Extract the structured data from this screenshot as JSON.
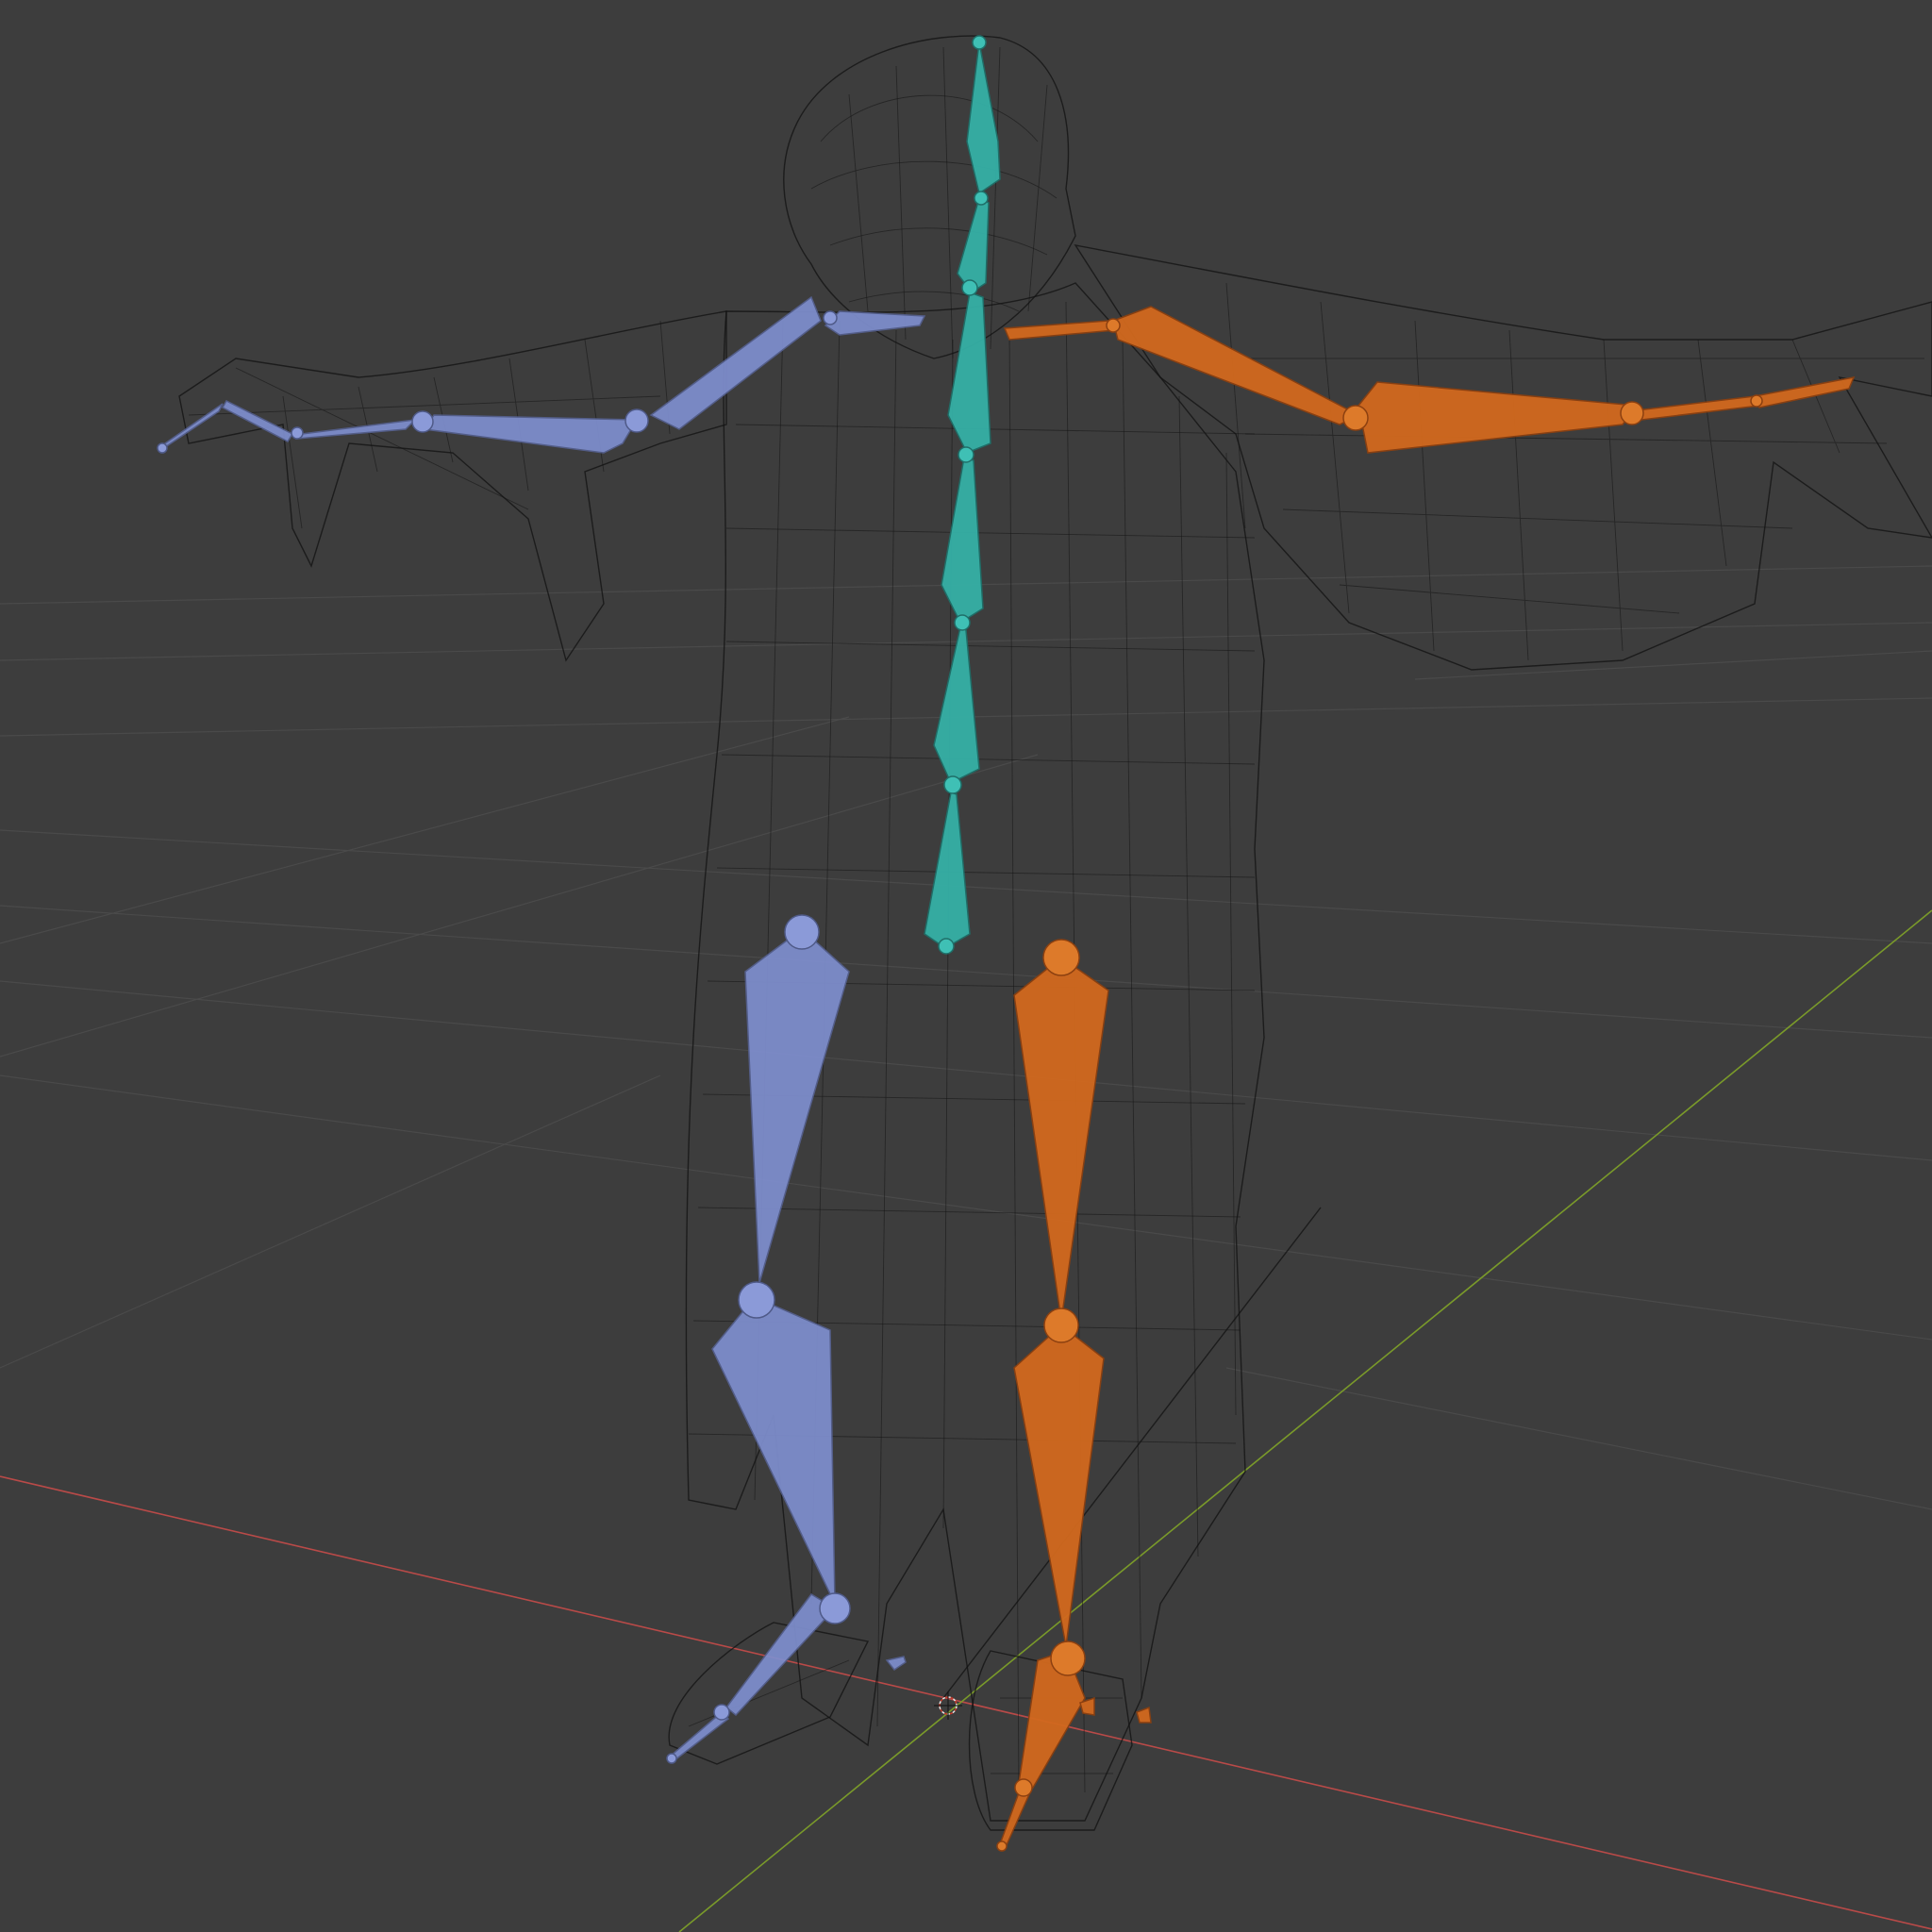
{
  "viewport": {
    "background": "#3d3d3d",
    "grid_color": "#4a4a4a",
    "x_axis_color": "#b94a48",
    "y_axis_color": "#7a9a2a"
  },
  "scene": {
    "object": "wireframe-character-mesh",
    "armature": {
      "left_side_color": "#7f8fcf",
      "right_side_color": "#d2691e",
      "spine_color": "#35b0a6"
    },
    "origin_marker": "3d-cursor-icon"
  }
}
